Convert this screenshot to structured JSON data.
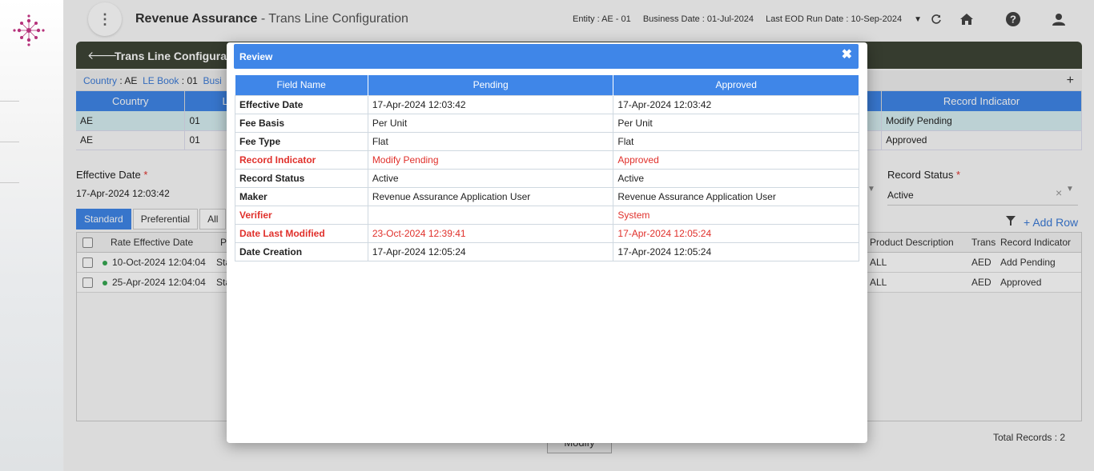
{
  "header": {
    "app_name": "Revenue Assurance",
    "page_name": " - Trans Line Configuration",
    "entity": "Entity : AE - 01",
    "business_date": "Business Date : 01-Jul-2024",
    "last_eod": "Last EOD Run Date : 10-Sep-2024"
  },
  "page": {
    "section_title": "Trans Line Configurati",
    "crumbs": {
      "country_label": "Country",
      "country_value": "AE",
      "lebook_label": "LE Book",
      "lebook_value": "01",
      "bus_label": "Busi"
    },
    "summary_table": {
      "columns": [
        "Country",
        "L",
        "Record Indicator"
      ],
      "rows": [
        {
          "country": "AE",
          "lebook": "01",
          "indicator": "Modify Pending"
        },
        {
          "country": "AE",
          "lebook": "01",
          "indicator": "Approved"
        }
      ]
    },
    "effective_date_label": "Effective Date",
    "effective_date_value": "17-Apr-2024 12:03:42",
    "record_status_label": "Record Status",
    "record_status_value": "Active",
    "required_mark": "*",
    "tabs": [
      "Standard",
      "Preferential",
      "All"
    ],
    "add_row": "Add Row",
    "grid": {
      "columns": {
        "rate_eff": "Rate Effective Date",
        "p": "P",
        "prod_desc": "Product Description",
        "trans": "Trans",
        "rec_ind": "Record Indicator"
      },
      "rows": [
        {
          "date": "10-Oct-2024 12:04:04",
          "p": "Sta",
          "prod": "ALL",
          "trans": "AED",
          "ind": "Add Pending"
        },
        {
          "date": "25-Apr-2024 12:04:04",
          "p": "Sta",
          "prod": "ALL",
          "trans": "AED",
          "ind": "Approved"
        }
      ]
    },
    "modify_button": "Modify",
    "total_records": "Total Records  :  2"
  },
  "modal": {
    "title": "Review",
    "columns": {
      "field": "Field Name",
      "pending": "Pending",
      "approved": "Approved"
    },
    "rows": [
      {
        "field": "Effective Date",
        "pending": "17-Apr-2024 12:03:42",
        "approved": "17-Apr-2024 12:03:42"
      },
      {
        "field": "Fee Basis",
        "pending": "Per Unit",
        "approved": "Per Unit"
      },
      {
        "field": "Fee Type",
        "pending": "Flat",
        "approved": "Flat"
      },
      {
        "field": "Record Indicator",
        "pending": "Modify Pending",
        "approved": "Approved"
      },
      {
        "field": "Record Status",
        "pending": "Active",
        "approved": "Active"
      },
      {
        "field": "Maker",
        "pending": "Revenue Assurance Application User",
        "approved": "Revenue Assurance Application User"
      },
      {
        "field": "Verifier",
        "pending": "",
        "approved": "System"
      },
      {
        "field": "Date Last Modified",
        "pending": "23-Oct-2024 12:39:41",
        "approved": "17-Apr-2024 12:05:24"
      },
      {
        "field": "Date Creation",
        "pending": "17-Apr-2024 12:05:24",
        "approved": "17-Apr-2024 12:05:24"
      }
    ]
  },
  "colors": {
    "accent": "#3f86e8",
    "changed": "#e0302b",
    "header_bar": "#3e4536"
  }
}
